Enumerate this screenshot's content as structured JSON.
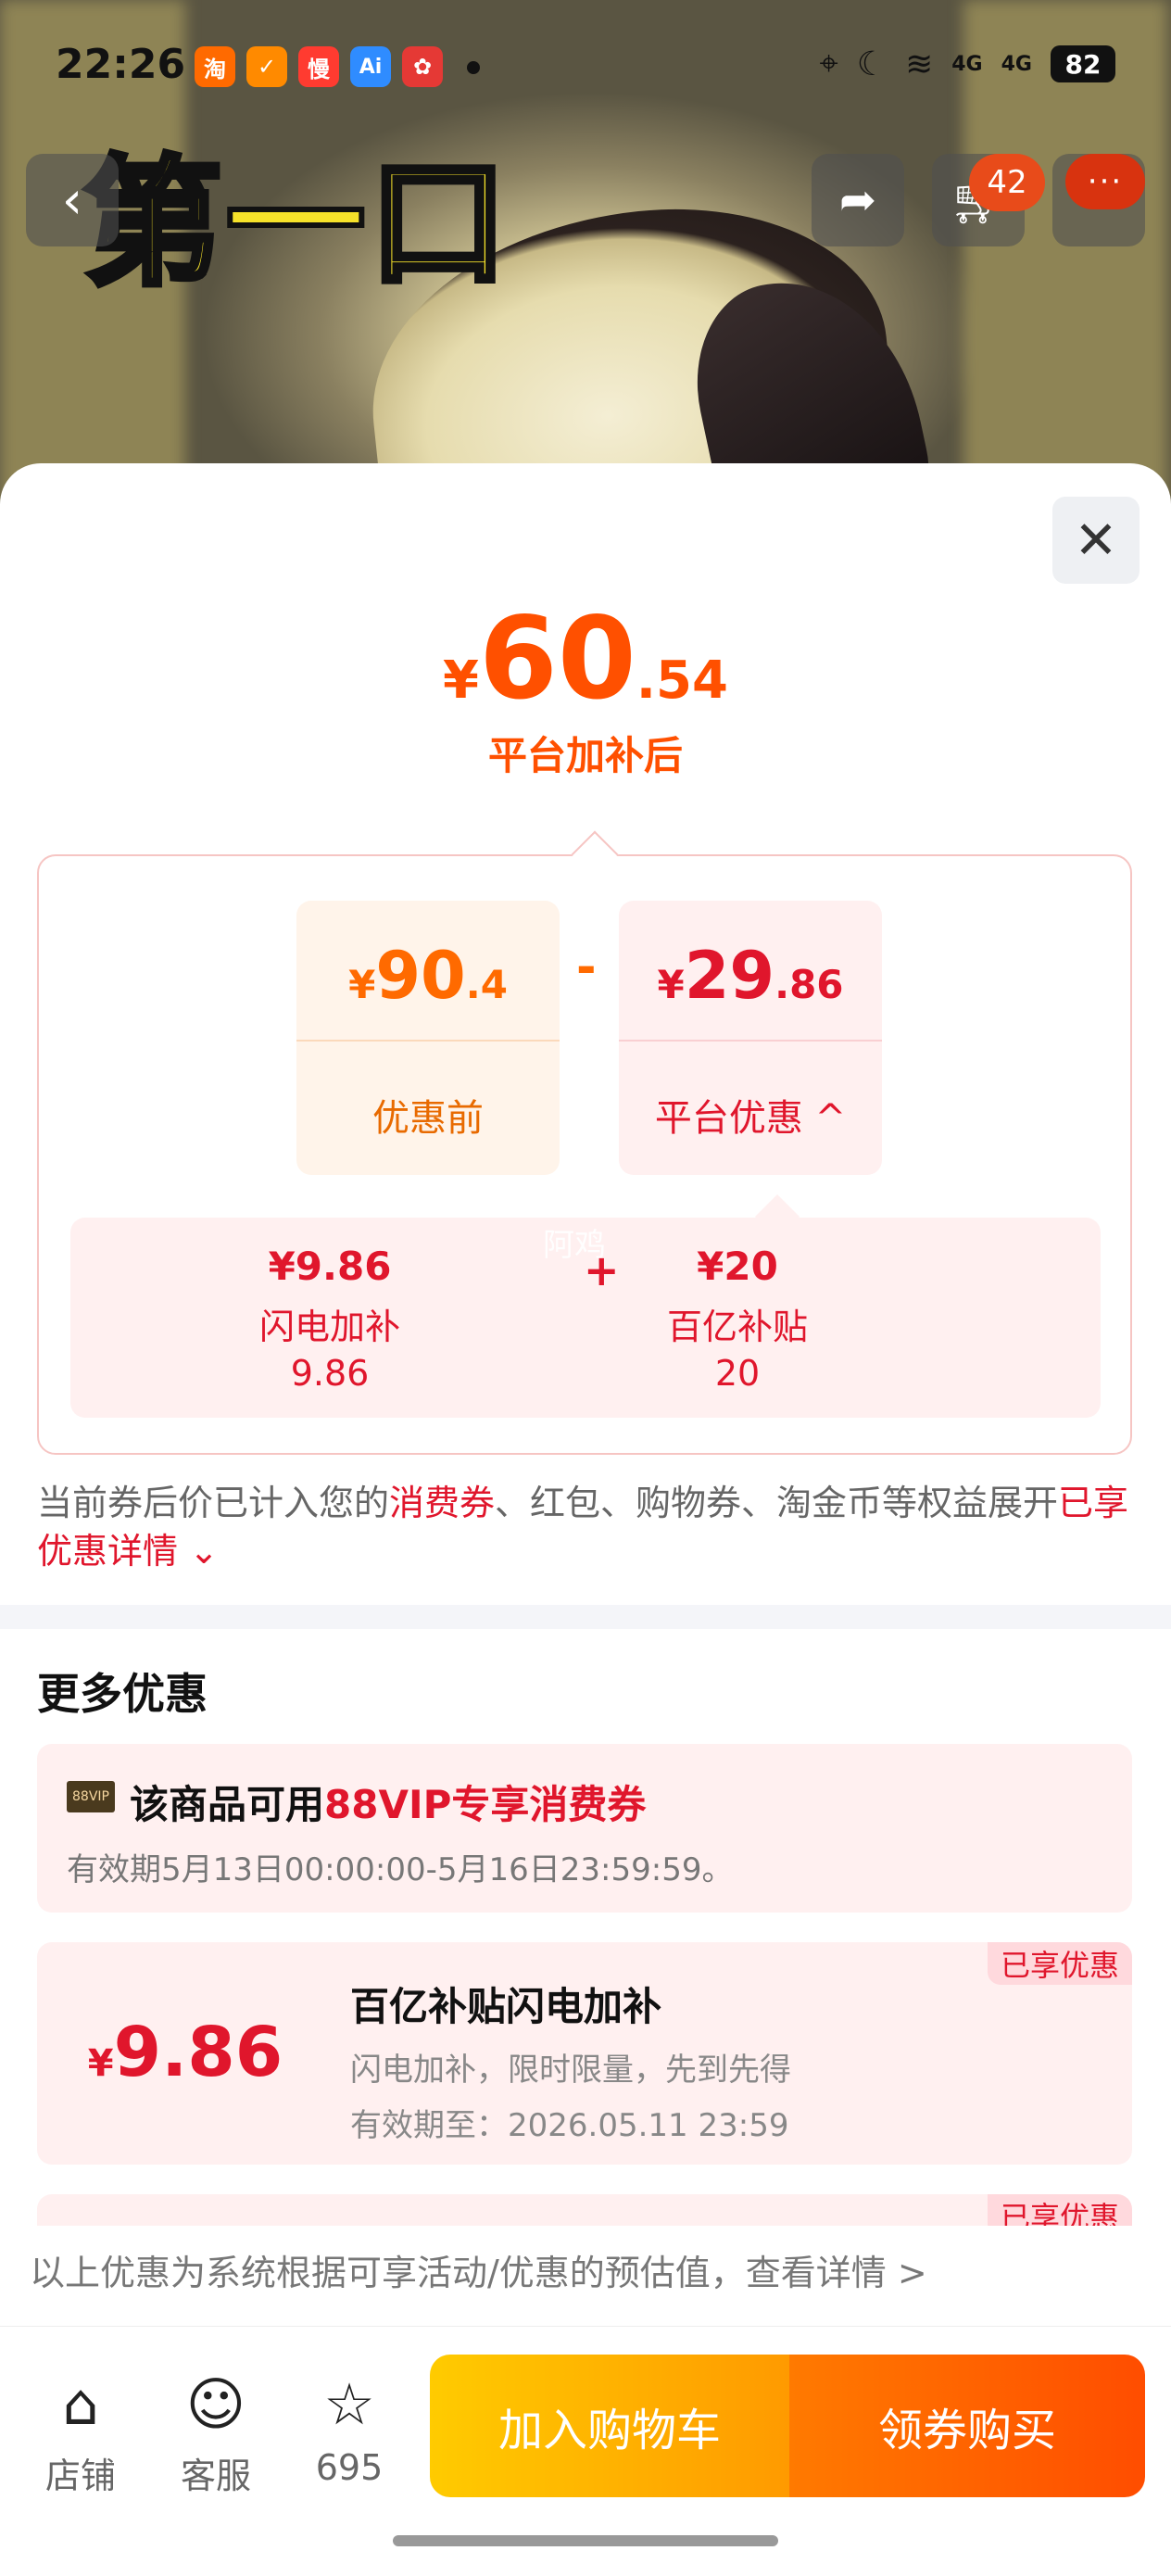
{
  "status": {
    "time": "22:26",
    "battery": "82",
    "net1": "4G",
    "net2": "4G",
    "apps": [
      {
        "icon": "taobao-icon",
        "glyph": "淘",
        "color": "#ff6a00"
      },
      {
        "icon": "xianyu-icon",
        "glyph": "✓",
        "color": "#ff8a00"
      },
      {
        "icon": "man-icon",
        "glyph": "慢",
        "color": "#ff3b30"
      },
      {
        "icon": "ai-icon",
        "glyph": "Ai",
        "color": "#2f8cff"
      },
      {
        "icon": "game-icon",
        "glyph": "✿",
        "color": "#e53935"
      }
    ]
  },
  "hero": {
    "banner_text": "第一口",
    "cart_count": "42",
    "more": "···"
  },
  "price": {
    "currency": "¥",
    "integer": "60",
    "decimal": ".54",
    "label": "平台加补后"
  },
  "calc": {
    "before": {
      "currency": "¥",
      "integer": "90",
      "decimal": ".4",
      "label": "优惠前"
    },
    "minus": "-",
    "discount": {
      "currency": "¥",
      "integer": "29",
      "decimal": ".86",
      "label": "平台优惠",
      "chevron": "^"
    },
    "watermark": "阿鸡",
    "plus": "+",
    "items": [
      {
        "value": "¥9.86",
        "name": "闪电加补",
        "amount": "9.86"
      },
      {
        "value": "¥20",
        "name": "百亿补贴",
        "amount": "20"
      }
    ]
  },
  "note": {
    "text1": "当前券后价已计入您的",
    "hl1": "消费券",
    "text2": "、红包、购物券、淘金币等权益展开",
    "hl2": "已享优惠详情",
    "chevron": "⌄"
  },
  "more": {
    "title": "更多优惠",
    "vip": {
      "badge": "88VIP",
      "prefix": "该商品可用",
      "highlight": "88VIP专享消费券",
      "validity": "有效期5月13日00:00:00-5月16日23:59:59。"
    },
    "coupon": {
      "currency": "¥",
      "amount": "9.86",
      "title": "百亿补贴闪电加补",
      "desc": "闪电加补，限时限量，先到先得",
      "validity": "有效期至：2026.05.11 23:59",
      "tag": "已享优惠"
    },
    "coupon2_tag": "已享优惠"
  },
  "disclaimer": "以上优惠为系统根据可享活动/优惠的预估值，查看详情 >",
  "bottom": {
    "store": "店铺",
    "service": "客服",
    "favorites": "695",
    "add_cart": "加入购物车",
    "buy": "领券购买"
  }
}
